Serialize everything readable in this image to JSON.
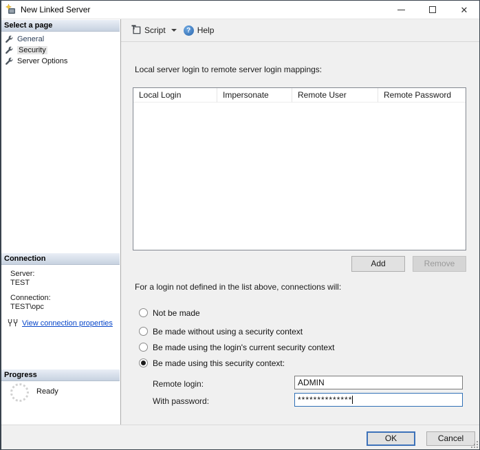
{
  "window": {
    "title": "New Linked Server"
  },
  "sidebar": {
    "pages_header": "Select a page",
    "pages": [
      {
        "label": "General",
        "selected": false
      },
      {
        "label": "Security",
        "selected": true
      },
      {
        "label": "Server Options",
        "selected": false
      }
    ],
    "connection_header": "Connection",
    "server_label": "Server:",
    "server_value": "TEST",
    "connection_label": "Connection:",
    "connection_value": "TEST\\opc",
    "view_connection_link": "View connection properties",
    "progress_header": "Progress",
    "progress_status": "Ready"
  },
  "toolbar": {
    "script_label": "Script",
    "help_label": "Help",
    "help_glyph": "?"
  },
  "main": {
    "mappings_label": "Local server login to remote server login mappings:",
    "table_columns": [
      "Local Login",
      "Impersonate",
      "Remote User",
      "Remote Password"
    ],
    "table_rows": [],
    "add_label": "Add",
    "remove_label": "Remove",
    "fallback_label": "For a login not defined in the list above, connections will:",
    "radio_options": [
      {
        "label": "Not be made",
        "selected": false
      },
      {
        "label": "Be made without using a security context",
        "selected": false
      },
      {
        "label": "Be made using the login's current security context",
        "selected": false
      },
      {
        "label": "Be made using this security context:",
        "selected": true
      }
    ],
    "remote_login_label": "Remote login:",
    "remote_login_value": "ADMIN",
    "password_label": "With password:",
    "password_masked": "**************"
  },
  "footer": {
    "ok_label": "OK",
    "cancel_label": "Cancel"
  },
  "colors": {
    "section_header_top": "#e9eef6",
    "section_header_bottom": "#c7d2e0",
    "link_blue": "#0645c9",
    "focus_blue": "#2e6fb5",
    "ok_focus_border": "#3c71b9",
    "window_bg": "#f0f0f0",
    "help_icon_blue": "#2a66ad"
  }
}
